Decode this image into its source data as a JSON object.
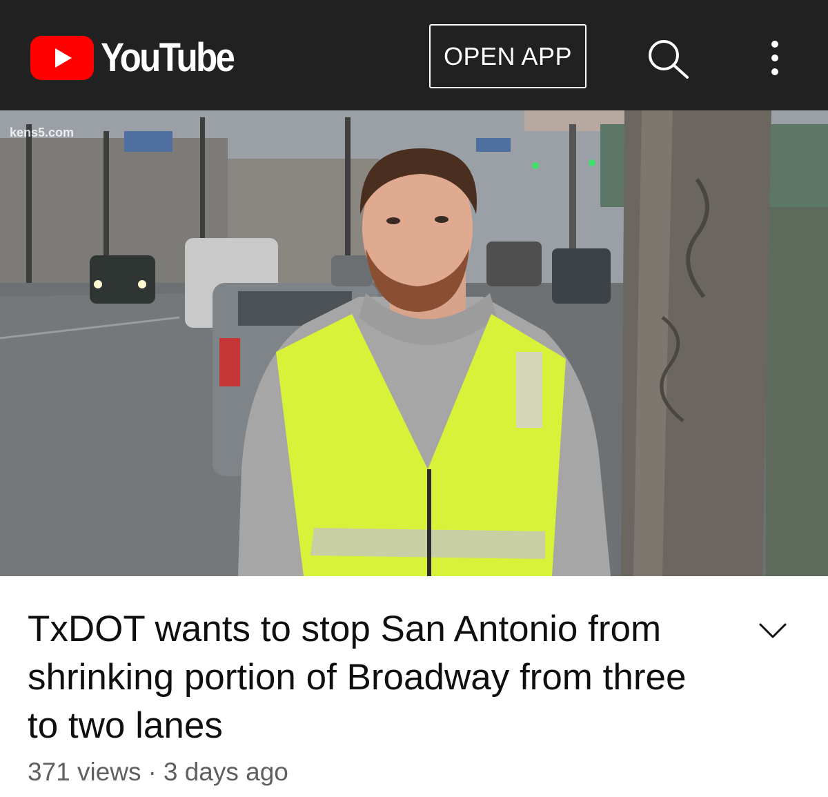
{
  "header": {
    "logo_text": "YouTube",
    "open_app_label": "OPEN APP",
    "search_icon": "search-icon",
    "more_icon": "more-vert-icon"
  },
  "player": {
    "watermark": "kens5.com"
  },
  "video": {
    "title": "TxDOT wants to stop San Antonio from shrinking portion of Broadway from three to two lanes",
    "views": "371 views",
    "separator": "·",
    "age": "3 days ago",
    "expand_icon": "chevron-down-icon"
  },
  "colors": {
    "header_bg": "#212121",
    "brand_red": "#ff0000",
    "title_text": "#0f0f0f",
    "meta_text": "#606060",
    "vest": "#d8f23a"
  }
}
